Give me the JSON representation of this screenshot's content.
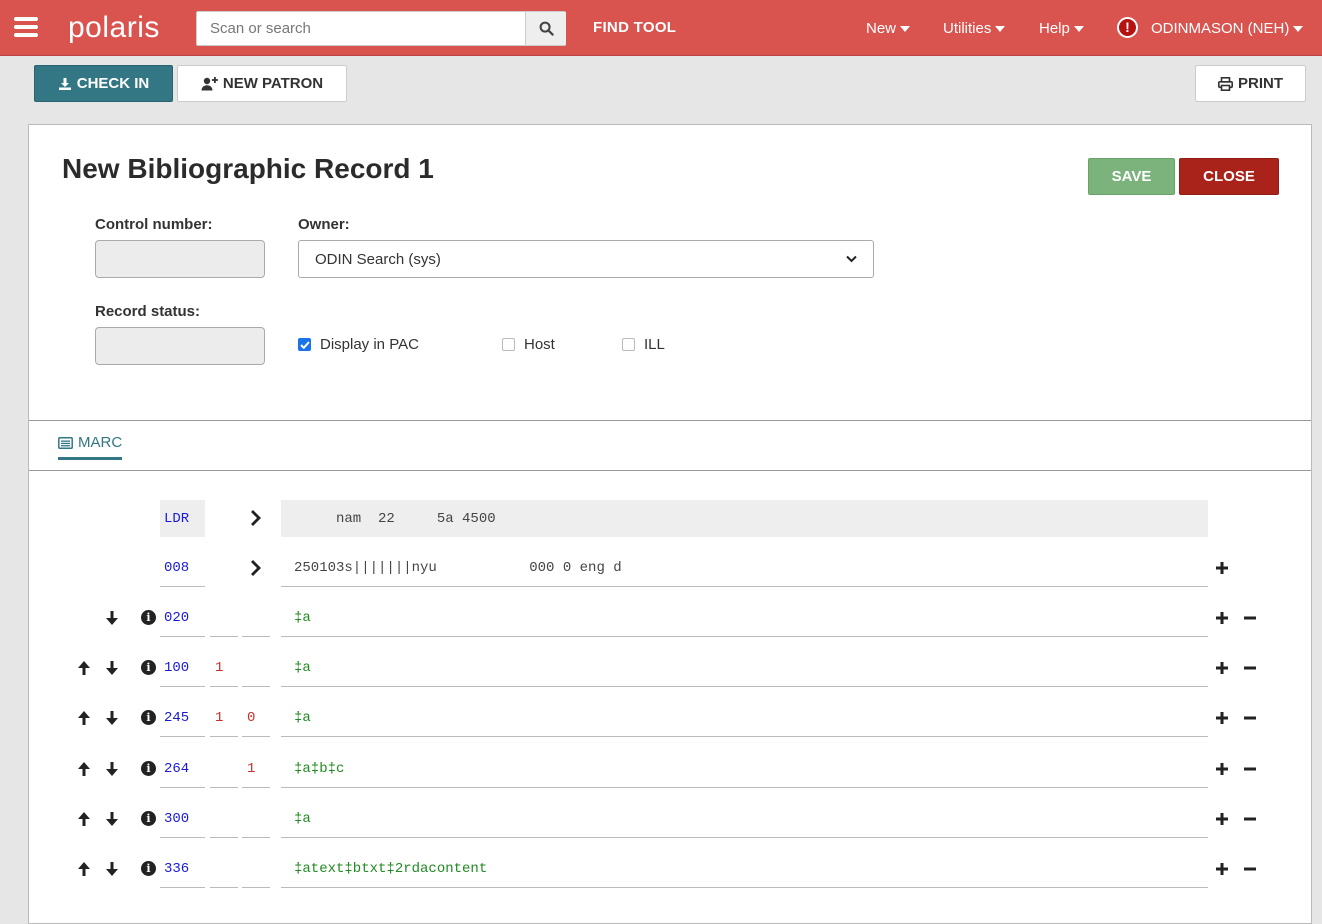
{
  "nav": {
    "logo": "polaris",
    "search_placeholder": "Scan or search",
    "find_tool": "FIND TOOL",
    "menu_new": "New",
    "menu_utilities": "Utilities",
    "menu_help": "Help",
    "user": "ODINMASON (NEH)"
  },
  "toolbar": {
    "check_in": "CHECK IN",
    "new_patron": "NEW PATRON",
    "print": "PRINT"
  },
  "record": {
    "title": "New Bibliographic Record 1",
    "save": "SAVE",
    "close": "CLOSE",
    "control_number_label": "Control number:",
    "owner_label": "Owner:",
    "owner_value": "ODIN Search (sys)",
    "record_status_label": "Record status:",
    "display_in_pac": "Display in PAC",
    "display_in_pac_checked": true,
    "host": "Host",
    "host_checked": false,
    "ill": "ILL",
    "ill_checked": false
  },
  "tabs": {
    "marc": "MARC"
  },
  "marc": [
    {
      "tag": "LDR",
      "ind1": "",
      "ind2": "",
      "data": "     nam  22     5a 4500"
    },
    {
      "tag": "008",
      "ind1": "",
      "ind2": "",
      "data": "250103s|||||||nyu           000 0 eng d"
    },
    {
      "tag": "020",
      "ind1": "",
      "ind2": "",
      "data": "‡a"
    },
    {
      "tag": "100",
      "ind1": "1",
      "ind2": "",
      "data": "‡a"
    },
    {
      "tag": "245",
      "ind1": "1",
      "ind2": "0",
      "data": "‡a"
    },
    {
      "tag": "264",
      "ind1": "",
      "ind2": "1",
      "data": "‡a‡b‡c"
    },
    {
      "tag": "300",
      "ind1": "",
      "ind2": "",
      "data": "‡a"
    },
    {
      "tag": "336",
      "ind1": "",
      "ind2": "",
      "data": "‡atext‡btxt‡2rdacontent"
    }
  ]
}
